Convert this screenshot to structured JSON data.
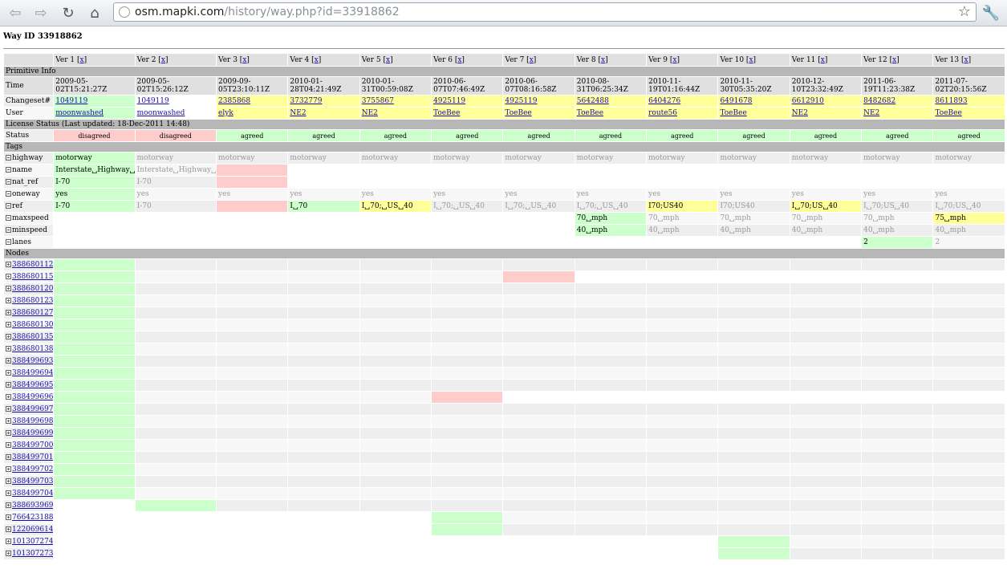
{
  "browser": {
    "url_host": "osm.mapki.com",
    "url_path": "/history/way.php?id=33918862"
  },
  "page": {
    "title": "Way ID 33918862",
    "sections": {
      "primitive": "Primitive Info",
      "license": "License Status (Last updated: 18-Dec-2011 14:48)",
      "tags": "Tags",
      "nodes": "Nodes"
    },
    "labels": {
      "time": "Time",
      "changeset": "Changeset#",
      "user": "User",
      "status": "Status"
    }
  },
  "versions": [
    {
      "label": "Ver 1 [",
      "x": "x",
      "close": "]",
      "time": "2009-05-02T15:21:27Z",
      "changeset": "1049119",
      "user": "moonwashed",
      "status": "disagreed"
    },
    {
      "label": "Ver 2 [",
      "x": "x",
      "close": "]",
      "time": "2009-05-02T15:26:12Z",
      "changeset": "1049119",
      "user": "moonwashed",
      "status": "disagreed"
    },
    {
      "label": "Ver 3 [",
      "x": "x",
      "close": "]",
      "time": "2009-09-05T23:10:11Z",
      "changeset": "2385868",
      "user": "elyk",
      "status": "agreed"
    },
    {
      "label": "Ver 4 [",
      "x": "x",
      "close": "]",
      "time": "2010-01-28T04:21:49Z",
      "changeset": "3732779",
      "user": "NE2",
      "status": "agreed"
    },
    {
      "label": "Ver 5 [",
      "x": "x",
      "close": "]",
      "time": "2010-01-31T00:59:08Z",
      "changeset": "3755867",
      "user": "NE2",
      "status": "agreed"
    },
    {
      "label": "Ver 6 [",
      "x": "x",
      "close": "]",
      "time": "2010-06-07T07:46:49Z",
      "changeset": "4925119",
      "user": "ToeBee",
      "status": "agreed"
    },
    {
      "label": "Ver 7 [",
      "x": "x",
      "close": "]",
      "time": "2010-06-07T08:16:58Z",
      "changeset": "4925119",
      "user": "ToeBee",
      "status": "agreed"
    },
    {
      "label": "Ver 8 [",
      "x": "x",
      "close": "]",
      "time": "2010-08-31T06:25:34Z",
      "changeset": "5642488",
      "user": "ToeBee",
      "status": "agreed"
    },
    {
      "label": "Ver 9 [",
      "x": "x",
      "close": "]",
      "time": "2010-11-19T01:16:44Z",
      "changeset": "6404276",
      "user": "route56",
      "status": "agreed"
    },
    {
      "label": "Ver 10 [",
      "x": "x",
      "close": "]",
      "time": "2010-11-30T05:35:20Z",
      "changeset": "6491678",
      "user": "ToeBee",
      "status": "agreed"
    },
    {
      "label": "Ver 11 [",
      "x": "x",
      "close": "]",
      "time": "2010-12-10T23:32:49Z",
      "changeset": "6612910",
      "user": "NE2",
      "status": "agreed"
    },
    {
      "label": "Ver 12 [",
      "x": "x",
      "close": "]",
      "time": "2011-06-19T11:23:38Z",
      "changeset": "8482682",
      "user": "NE2",
      "status": "agreed"
    },
    {
      "label": "Ver 13 [",
      "x": "x",
      "close": "]",
      "time": "2011-07-02T20:15:56Z",
      "changeset": "8611893",
      "user": "ToeBee",
      "status": "agreed"
    }
  ],
  "tags": [
    {
      "key": "highway",
      "cells": [
        "motorway",
        "motorway",
        "motorway",
        "motorway",
        "motorway",
        "motorway",
        "motorway",
        "motorway",
        "motorway",
        "motorway",
        "motorway",
        "motorway",
        "motorway"
      ]
    },
    {
      "key": "name",
      "cells": [
        "Interstate␣Highway␣7…",
        "Interstate␣Highway␣7…",
        "",
        "",
        "",
        "",
        "",
        "",
        "",
        "",
        "",
        "",
        ""
      ]
    },
    {
      "key": "nat_ref",
      "cells": [
        "I-70",
        "I-70",
        "",
        "",
        "",
        "",
        "",
        "",
        "",
        "",
        "",
        "",
        ""
      ]
    },
    {
      "key": "oneway",
      "cells": [
        "yes",
        "yes",
        "yes",
        "yes",
        "yes",
        "yes",
        "yes",
        "yes",
        "yes",
        "yes",
        "yes",
        "yes",
        "yes"
      ]
    },
    {
      "key": "ref",
      "cells": [
        "I-70",
        "I-70",
        "",
        "I␣70",
        "I␣70;␣US␣40",
        "I␣70;␣US␣40",
        "I␣70;␣US␣40",
        "I␣70;␣US␣40",
        "I70;US40",
        "I70;US40",
        "I␣70;US␣40",
        "I␣70;US␣40",
        "I␣70;US␣40"
      ]
    },
    {
      "key": "maxspeed",
      "cells": [
        "",
        "",
        "",
        "",
        "",
        "",
        "",
        "70␣mph",
        "70␣mph",
        "70␣mph",
        "70␣mph",
        "70␣mph",
        "75␣mph"
      ]
    },
    {
      "key": "minspeed",
      "cells": [
        "",
        "",
        "",
        "",
        "",
        "",
        "",
        "40␣mph",
        "40␣mph",
        "40␣mph",
        "40␣mph",
        "40␣mph",
        "40␣mph"
      ]
    },
    {
      "key": "lanes",
      "cells": [
        "",
        "",
        "",
        "",
        "",
        "",
        "",
        "",
        "",
        "",
        "",
        "2",
        "2"
      ]
    }
  ],
  "nodes": [
    "388680112",
    "388680115",
    "388680120",
    "388680123",
    "388680127",
    "388680130",
    "388680135",
    "388680138",
    "388499693",
    "388499694",
    "388499695",
    "388499696",
    "388499697",
    "388499698",
    "388499699",
    "388499700",
    "388499701",
    "388499702",
    "388499703",
    "388499704",
    "388693969",
    "766423188",
    "122069614",
    "1013072747",
    "1013072736"
  ]
}
